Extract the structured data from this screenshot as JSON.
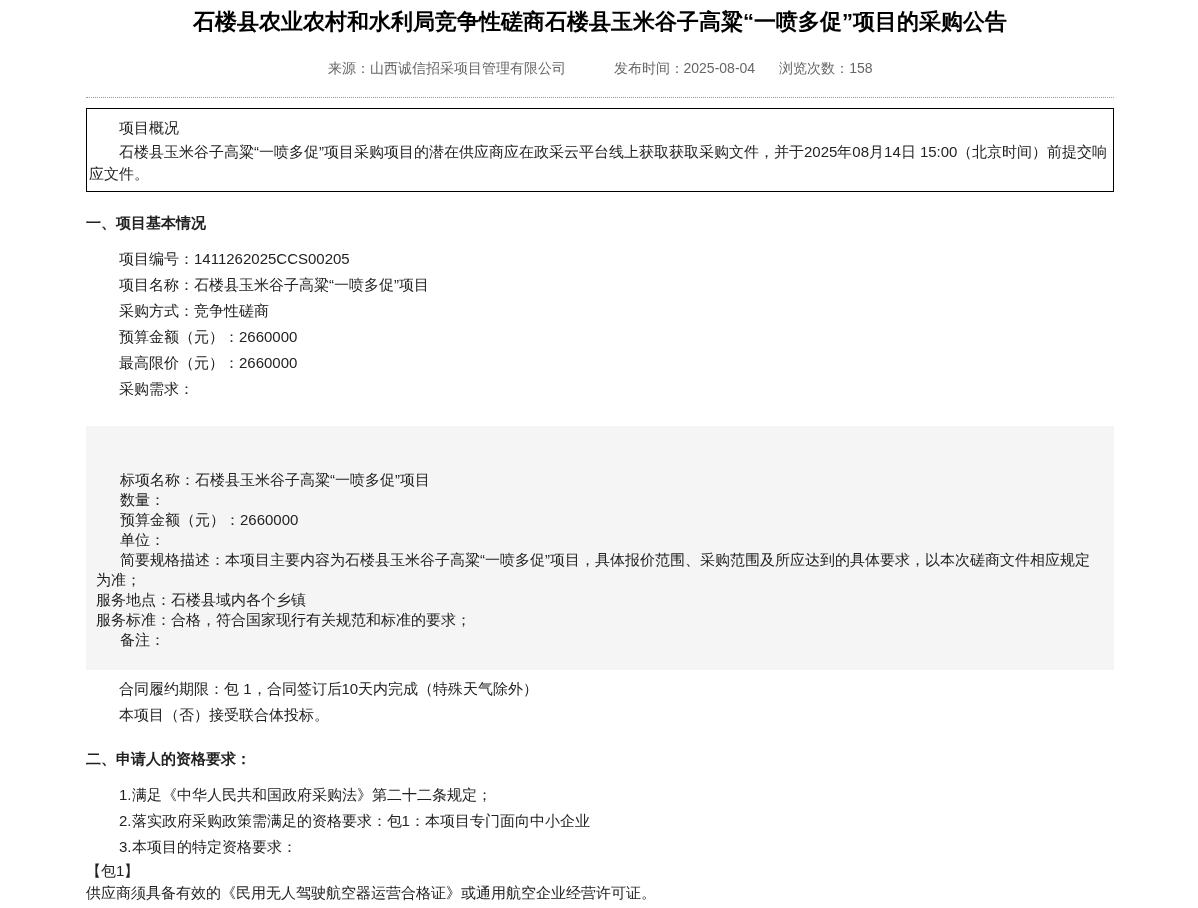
{
  "title": "石楼县农业农村和水利局竞争性磋商石楼县玉米谷子高粱“一喷多促”项目的采购公告",
  "meta": [
    "来源：山西诚信招采项目管理有限公司",
    "发布时间：2025-08-04",
    "浏览次数：158"
  ],
  "summary": {
    "heading": "项目概况",
    "text": "石楼县玉米谷子高粱“一喷多促”项目采购项目的潜在供应商应在政采云平台线上获取获取采购文件，并于2025年08月14日 15:00（北京时间）前提交响应文件。"
  },
  "sections": [
    {
      "heading": "一、项目基本情况",
      "blocks": [
        {
          "kind": "lines",
          "lines": [
            {
              "kind": "indented",
              "text": "项目编号：1411262025CCS00205"
            },
            {
              "kind": "indented",
              "text": "项目名称：石楼县玉米谷子高粱“一喷多促”项目"
            },
            {
              "kind": "indented",
              "text": "采购方式：竞争性磋商"
            },
            {
              "kind": "indented",
              "text": "预算金额（元）：2660000"
            },
            {
              "kind": "indented",
              "text": "最高限价（元）：2660000"
            },
            {
              "kind": "indented",
              "text": "采购需求："
            }
          ]
        },
        {
          "kind": "panel",
          "lines": [
            {
              "kind": "indented",
              "text": "标项名称：石楼县玉米谷子高粱“一喷多促”项目"
            },
            {
              "kind": "indented",
              "text": "数量："
            },
            {
              "kind": "indented",
              "text": "预算金额（元）：2660000"
            },
            {
              "kind": "indented",
              "text": "单位："
            },
            {
              "kind": "indented",
              "text": "简要规格描述：本项目主要内容为石楼县玉米谷子高粱“一喷多促”项目，具体报价范围、采购范围及所应达到的具体要求，以本次磋商文件相应规定为准；"
            },
            {
              "kind": "flush",
              "text": "服务地点：石楼县域内各个乡镇"
            },
            {
              "kind": "flush",
              "text": "服务标准：合格，符合国家现行有关规范和标准的要求；"
            },
            {
              "kind": "indented",
              "text": "备注："
            }
          ]
        },
        {
          "kind": "lines",
          "lines": [
            {
              "kind": "indented",
              "text": "合同履约期限：包 1，合同签订后10天内完成（特殊天气除外）"
            },
            {
              "kind": "indented",
              "text": "本项目（否）接受联合体投标。"
            }
          ]
        }
      ]
    },
    {
      "heading": "二、申请人的资格要求：",
      "blocks": [
        {
          "kind": "lines",
          "lines": [
            {
              "kind": "indented",
              "text": "1.满足《中华人民共和国政府采购法》第二十二条规定；"
            },
            {
              "kind": "indented",
              "text": "2.落实政府采购政策需满足的资格要求：包1：本项目专门面向中小企业"
            },
            {
              "kind": "indented",
              "text": "3.本项目的特定资格要求："
            }
          ]
        },
        {
          "kind": "plain",
          "lines": [
            {
              "kind": "flush",
              "text": "【包1】"
            },
            {
              "kind": "flush",
              "text": "供应商须具备有效的《民用无人驾驶航空器运营合格证》或通用航空企业经营许可证。"
            }
          ]
        }
      ]
    }
  ]
}
